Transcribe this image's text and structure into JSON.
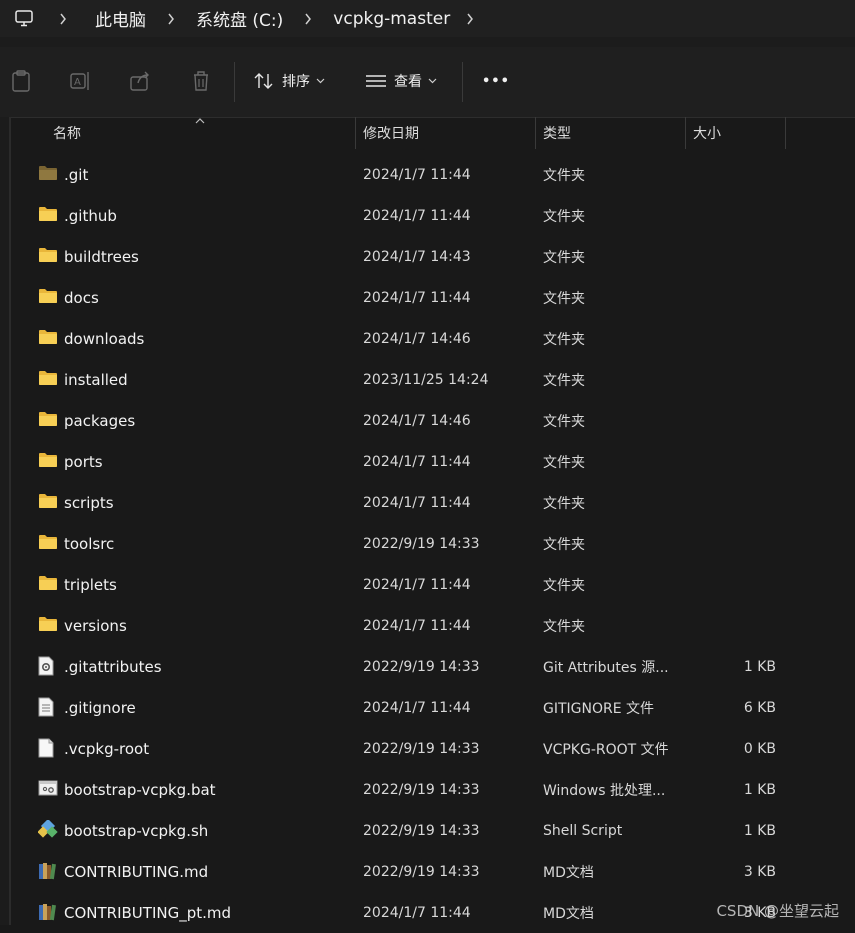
{
  "breadcrumb": {
    "items": [
      "此电脑",
      "系统盘 (C:)",
      "vcpkg-master"
    ]
  },
  "toolbar": {
    "sort_label": "排序",
    "view_label": "查看",
    "more_label": "•••"
  },
  "columns": {
    "name": "名称",
    "date": "修改日期",
    "type": "类型",
    "size": "大小"
  },
  "files": [
    {
      "name": ".git",
      "date": "2024/1/7 11:44",
      "type": "文件夹",
      "size": "",
      "icon": "folder-dim-icon"
    },
    {
      "name": ".github",
      "date": "2024/1/7 11:44",
      "type": "文件夹",
      "size": "",
      "icon": "folder-icon"
    },
    {
      "name": "buildtrees",
      "date": "2024/1/7 14:43",
      "type": "文件夹",
      "size": "",
      "icon": "folder-icon"
    },
    {
      "name": "docs",
      "date": "2024/1/7 11:44",
      "type": "文件夹",
      "size": "",
      "icon": "folder-icon"
    },
    {
      "name": "downloads",
      "date": "2024/1/7 14:46",
      "type": "文件夹",
      "size": "",
      "icon": "folder-icon"
    },
    {
      "name": "installed",
      "date": "2023/11/25 14:24",
      "type": "文件夹",
      "size": "",
      "icon": "folder-icon"
    },
    {
      "name": "packages",
      "date": "2024/1/7 14:46",
      "type": "文件夹",
      "size": "",
      "icon": "folder-icon"
    },
    {
      "name": "ports",
      "date": "2024/1/7 11:44",
      "type": "文件夹",
      "size": "",
      "icon": "folder-icon"
    },
    {
      "name": "scripts",
      "date": "2024/1/7 11:44",
      "type": "文件夹",
      "size": "",
      "icon": "folder-icon"
    },
    {
      "name": "toolsrc",
      "date": "2022/9/19 14:33",
      "type": "文件夹",
      "size": "",
      "icon": "folder-icon"
    },
    {
      "name": "triplets",
      "date": "2024/1/7 11:44",
      "type": "文件夹",
      "size": "",
      "icon": "folder-icon"
    },
    {
      "name": "versions",
      "date": "2024/1/7 11:44",
      "type": "文件夹",
      "size": "",
      "icon": "folder-icon"
    },
    {
      "name": ".gitattributes",
      "date": "2022/9/19 14:33",
      "type": "Git Attributes 源...",
      "size": "1 KB",
      "icon": "settings-file-icon"
    },
    {
      "name": ".gitignore",
      "date": "2024/1/7 11:44",
      "type": "GITIGNORE 文件",
      "size": "6 KB",
      "icon": "text-file-icon"
    },
    {
      "name": ".vcpkg-root",
      "date": "2022/9/19 14:33",
      "type": "VCPKG-ROOT 文件",
      "size": "0 KB",
      "icon": "blank-file-icon"
    },
    {
      "name": "bootstrap-vcpkg.bat",
      "date": "2022/9/19 14:33",
      "type": "Windows 批处理...",
      "size": "1 KB",
      "icon": "batch-file-icon"
    },
    {
      "name": "bootstrap-vcpkg.sh",
      "date": "2022/9/19 14:33",
      "type": "Shell Script",
      "size": "1 KB",
      "icon": "shell-script-icon"
    },
    {
      "name": "CONTRIBUTING.md",
      "date": "2022/9/19 14:33",
      "type": "MD文档",
      "size": "3 KB",
      "icon": "books-icon"
    },
    {
      "name": "CONTRIBUTING_pt.md",
      "date": "2024/1/7 11:44",
      "type": "MD文档",
      "size": "3 KB",
      "icon": "books-icon"
    }
  ],
  "watermark": "CSDN @坐望云起"
}
